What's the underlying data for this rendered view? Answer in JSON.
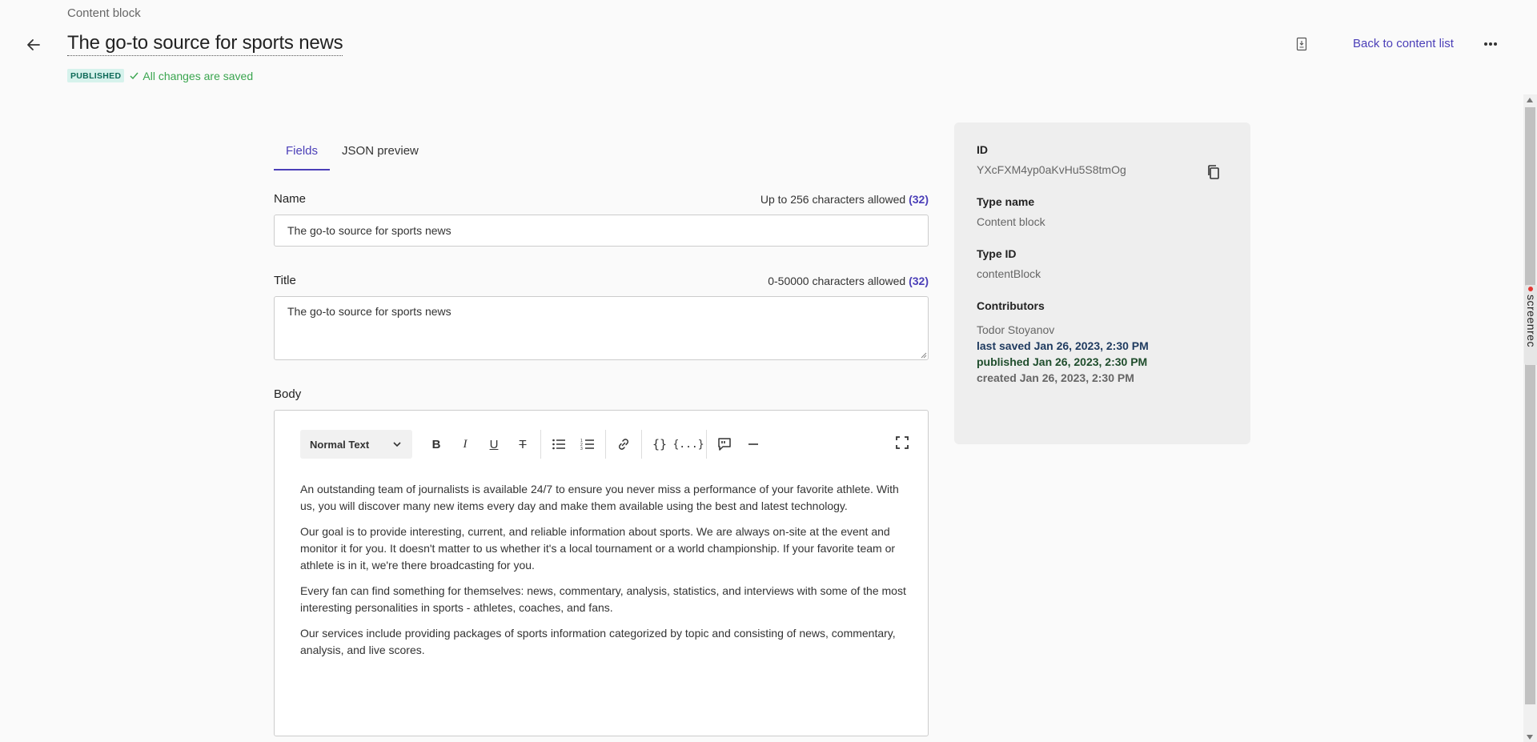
{
  "header": {
    "breadcrumb": "Content block",
    "title": "The go-to source for sports news",
    "status_badge": "PUBLISHED",
    "saved_text": "All changes are saved",
    "back_link": "Back to content list"
  },
  "tabs": [
    {
      "label": "Fields"
    },
    {
      "label": "JSON preview"
    }
  ],
  "fields": {
    "name": {
      "label": "Name",
      "hint": "Up to 256 characters allowed",
      "count": "(32)",
      "value": "The go-to source for sports news"
    },
    "title": {
      "label": "Title",
      "hint": "0-50000 characters allowed",
      "count": "(32)",
      "value": "The go-to source for sports news"
    },
    "body": {
      "label": "Body",
      "text_style": "Normal Text",
      "paragraphs": [
        "An outstanding team of journalists is available 24/7 to ensure you never miss a performance of your favorite athlete. With us, you will discover many new items every day and make them available using the best and latest technology.",
        "Our goal is to provide interesting, current, and reliable information about sports. We are always on-site at the event and monitor it for you. It doesn't matter to us whether it's a local tournament or a world championship. If your favorite team or athlete is in it, we're there broadcasting for you.",
        "Every fan can find something for themselves: news, commentary, analysis, statistics, and interviews with some of the most interesting personalities in sports - athletes, coaches, and fans.",
        "Our services include providing packages of sports information categorized by topic and consisting of news, commentary, analysis, and live scores."
      ]
    }
  },
  "meta": {
    "id_label": "ID",
    "id_value": "YXcFXM4yp0aKvHu5S8tmOg",
    "type_name_label": "Type name",
    "type_name_value": "Content block",
    "type_id_label": "Type ID",
    "type_id_value": "contentBlock",
    "contributors_label": "Contributors",
    "contributor": "Todor Stoyanov",
    "last_saved": "last saved Jan 26, 2023, 2:30 PM",
    "published": "published Jan 26, 2023, 2:30 PM",
    "created": "created Jan 26, 2023, 2:30 PM"
  },
  "overlay": {
    "recorder_label": "screenrec"
  },
  "colors": {
    "accent": "#4b3fb8",
    "saved": "#3aa54f",
    "badge_bg": "#d6f2ec",
    "last_saved": "#1e3a5f",
    "published": "#1f4d2c",
    "created": "#666666"
  }
}
